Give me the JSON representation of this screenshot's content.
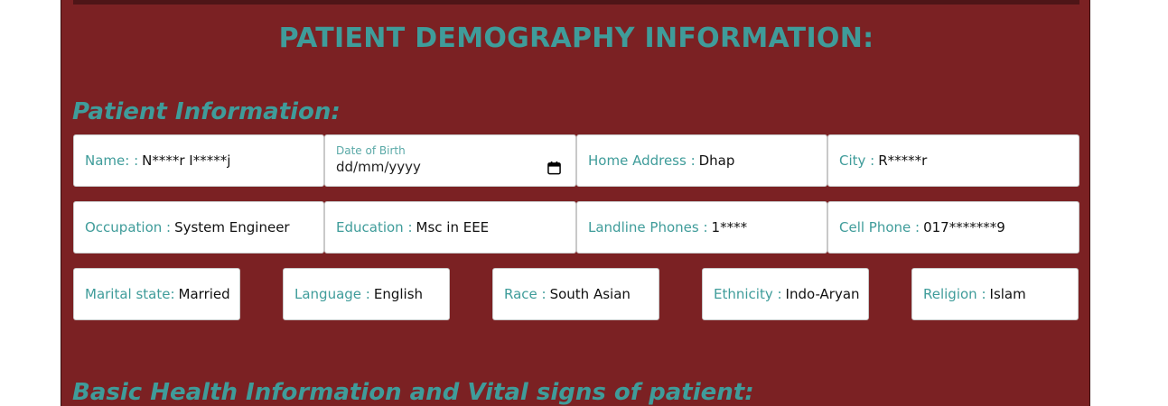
{
  "page": {
    "title": "PATIENT DEMOGRAPHY INFORMATION:"
  },
  "sections": {
    "patient_info": "Patient Information:",
    "basic_health": "Basic Health Information and Vital signs of patient:"
  },
  "fields": {
    "name": {
      "label": "Name: :",
      "value": "N****r I*****j"
    },
    "dob": {
      "label": "Date of Birth",
      "placeholder": "dd/mm/yyyy"
    },
    "home_address": {
      "label": "Home Address :",
      "value": "Dhap"
    },
    "city": {
      "label": "City :",
      "value": "R*****r"
    },
    "occupation": {
      "label": "Occupation :",
      "value": "System Engineer"
    },
    "education": {
      "label": "Education :",
      "value": "Msc in EEE"
    },
    "landline": {
      "label": "Landline Phones :",
      "value": "1****"
    },
    "cell": {
      "label": "Cell Phone :",
      "value": "017*******9"
    },
    "marital": {
      "label": "Marital state:",
      "value": "Married"
    },
    "language": {
      "label": "Language :",
      "value": "English"
    },
    "race": {
      "label": "Race :",
      "value": "South Asian"
    },
    "ethnicity": {
      "label": "Ethnicity :",
      "value": "Indo-Aryan"
    },
    "religion": {
      "label": "Religion :",
      "value": "Islam"
    }
  },
  "colors": {
    "panel_bg": "#7b2123",
    "accent_teal": "#3f9c9a",
    "field_bg": "#ffffff"
  },
  "icons": {
    "dob_picker": "calendar-icon"
  }
}
